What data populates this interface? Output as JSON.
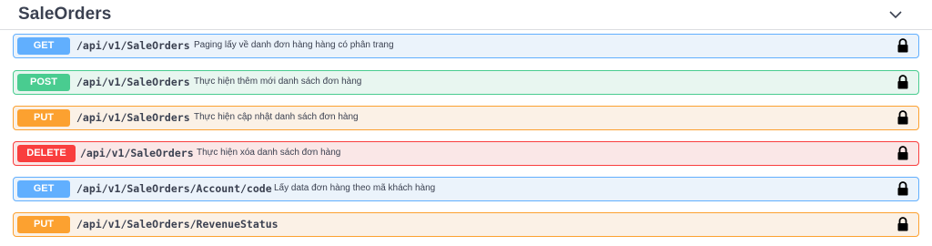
{
  "section": {
    "title": "SaleOrders"
  },
  "operations": [
    {
      "method": "GET",
      "path": "/api/v1/SaleOrders",
      "summary": "Paging lấy về danh đơn hàng hàng có phân trang"
    },
    {
      "method": "POST",
      "path": "/api/v1/SaleOrders",
      "summary": "Thực hiện thêm mới danh sách đơn hàng"
    },
    {
      "method": "PUT",
      "path": "/api/v1/SaleOrders",
      "summary": "Thực hiện cập nhật danh sách đơn hàng"
    },
    {
      "method": "DELETE",
      "path": "/api/v1/SaleOrders",
      "summary": "Thực hiện xóa danh sách đơn hàng"
    },
    {
      "method": "GET",
      "path": "/api/v1/SaleOrders/Account/code",
      "summary": "Lấy data đơn hàng theo mã khách hàng"
    },
    {
      "method": "PUT",
      "path": "/api/v1/SaleOrders/RevenueStatus",
      "summary": ""
    }
  ],
  "icons": {
    "toggle": "chevron-down-icon",
    "auth": "lock-icon"
  },
  "colors": {
    "get": "#61affe",
    "post": "#49cc90",
    "put": "#fca130",
    "delete": "#f93e3e"
  }
}
